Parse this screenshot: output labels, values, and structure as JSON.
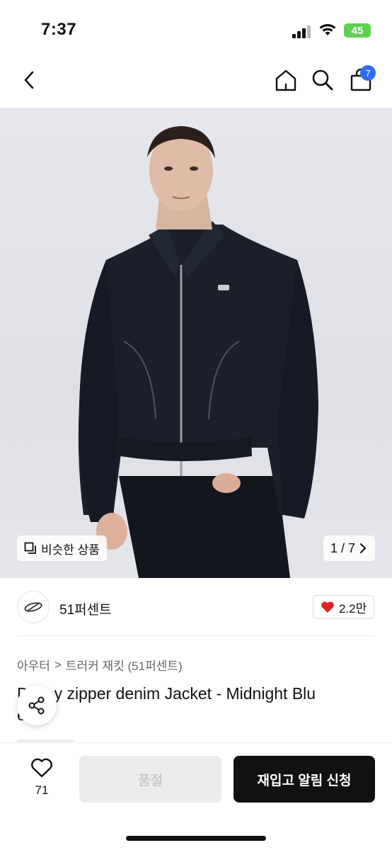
{
  "status_bar": {
    "time": "7:37",
    "battery": "45"
  },
  "nav": {
    "cart_count": "7"
  },
  "hero": {
    "similar_label": "비슷한 상품",
    "page_indicator": "1 / 7"
  },
  "shop": {
    "name": "51퍼센트",
    "likes": "2.2만"
  },
  "breadcrumb": {
    "category": "아우터",
    "separator": ">",
    "subcategory": "트러커 재킷 (51퍼센트)"
  },
  "product": {
    "title_line1": "y zipper denim Jacket - Midnight Blu",
    "title_line1_prefix": "D",
    "title_line2": "e"
  },
  "bottom_bar": {
    "wish_count": "71",
    "soldout_label": "품절",
    "restock_label": "재입고 알림 신청"
  },
  "colors": {
    "badge": "#2f6cf0",
    "heart": "#e02424",
    "primary_button": "#111111",
    "battery": "#5fcf52"
  }
}
